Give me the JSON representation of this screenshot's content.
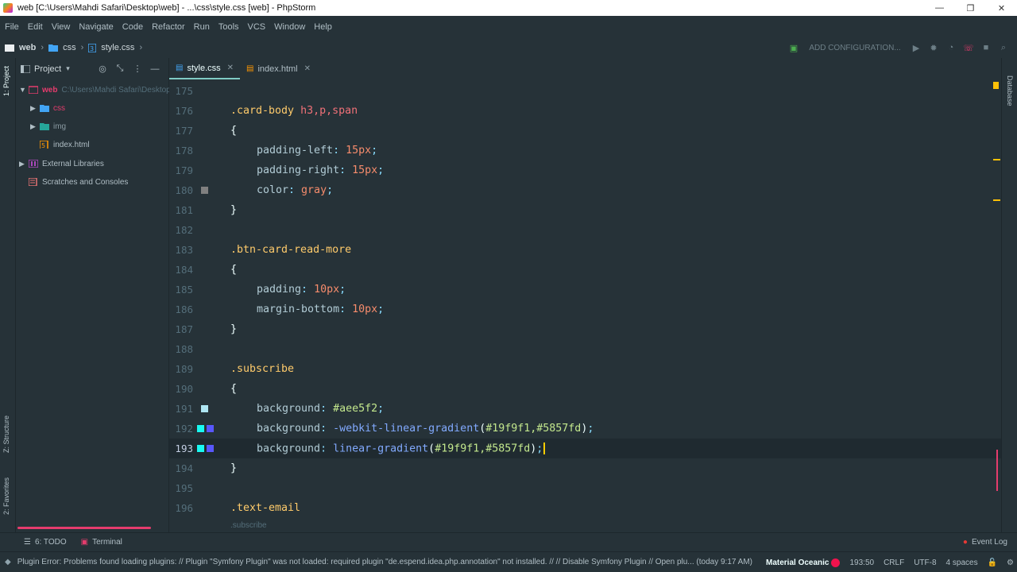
{
  "window": {
    "title": "web [C:\\Users\\Mahdi Safari\\Desktop\\web] - ...\\css\\style.css [web] - PhpStorm",
    "minimize": "—",
    "restore": "❐",
    "close": "✕"
  },
  "menu": [
    "File",
    "Edit",
    "View",
    "Navigate",
    "Code",
    "Refactor",
    "Run",
    "Tools",
    "VCS",
    "Window",
    "Help"
  ],
  "breadcrumbs": [
    "web",
    "css",
    "style.css"
  ],
  "toolbar": {
    "add_configuration": "ADD CONFIGURATION..."
  },
  "left_strip": {
    "project_label": "1: Project",
    "structure_label": "Z: Structure",
    "favorites_label": "2: Favorites"
  },
  "right_strip": {
    "database_label": "Database"
  },
  "project_panel": {
    "title": "Project",
    "tree": [
      {
        "label": "web",
        "path": "C:\\Users\\Mahdi Safari\\Desktop\\"
      },
      {
        "label": "css"
      },
      {
        "label": "img"
      },
      {
        "label": "index.html"
      },
      {
        "label": "External Libraries"
      },
      {
        "label": "Scratches and Consoles"
      }
    ]
  },
  "tabs": [
    {
      "label": "style.css",
      "active": true
    },
    {
      "label": "index.html",
      "active": false
    }
  ],
  "editor": {
    "current_line": 193,
    "lines": [
      {
        "n": "175"
      },
      {
        "n": "176"
      },
      {
        "n": "177"
      },
      {
        "n": "178"
      },
      {
        "n": "179"
      },
      {
        "n": "180"
      },
      {
        "n": "181"
      },
      {
        "n": "182"
      },
      {
        "n": "183"
      },
      {
        "n": "184"
      },
      {
        "n": "185"
      },
      {
        "n": "186"
      },
      {
        "n": "187"
      },
      {
        "n": "188"
      },
      {
        "n": "189"
      },
      {
        "n": "190"
      },
      {
        "n": "191"
      },
      {
        "n": "192"
      },
      {
        "n": "193"
      },
      {
        "n": "194"
      },
      {
        "n": "195"
      },
      {
        "n": "196"
      }
    ],
    "code": {
      "l176_sel": ".card-body ",
      "l176_tags": "h3,p,span",
      "l177": "{",
      "l178_prop": "padding-left",
      "l178_val": "15px",
      "l179_prop": "padding-right",
      "l179_val": "15px",
      "l180_prop": "color",
      "l180_val": "gray",
      "l181": "}",
      "l183_sel": ".btn-card-read-more",
      "l184": "{",
      "l185_prop": "padding",
      "l185_val": "10px",
      "l186_prop": "margin-bottom",
      "l186_val": "10px",
      "l187": "}",
      "l189_sel": ".subscribe",
      "l190": "{",
      "l191_prop": "background",
      "l191_val": "#aee5f2",
      "l192_prop": "background",
      "l192_fn": "-webkit-linear-gradient",
      "l192_args": "#19f9f1,#5857fd",
      "l193_prop": "background",
      "l193_fn": "linear-gradient",
      "l193_args": "#19f9f1,#5857fd",
      "l194": "}",
      "l196_sel": ".text-email"
    },
    "swatches": {
      "gray": "#808080",
      "aee5f2": "#aee5f2",
      "c19f9f1": "#19f9f1",
      "c5857fd": "#5857fd"
    }
  },
  "editor_breadcrumb": ".subscribe",
  "tool_windows": {
    "todo": "6: TODO",
    "terminal": "Terminal",
    "event_log": "Event Log"
  },
  "status": {
    "message": "Plugin Error: Problems found loading plugins: // Plugin \"Symfony Plugin\" was not loaded: required plugin \"de.espend.idea.php.annotation\" not installed. // // Disable Symfony Plugin // Open plu... (today 9:17 AM)",
    "theme": "Material Oceanic",
    "position": "193:50",
    "line_sep": "CRLF",
    "encoding": "UTF-8",
    "indent": "4 spaces"
  },
  "colors": {
    "background": "#263238",
    "accent": "#80cbc4",
    "selector": "#ffcb6b",
    "property": "#b2ccd6",
    "number": "#f78c6c",
    "function": "#82aaff",
    "hex": "#c3e88d"
  }
}
